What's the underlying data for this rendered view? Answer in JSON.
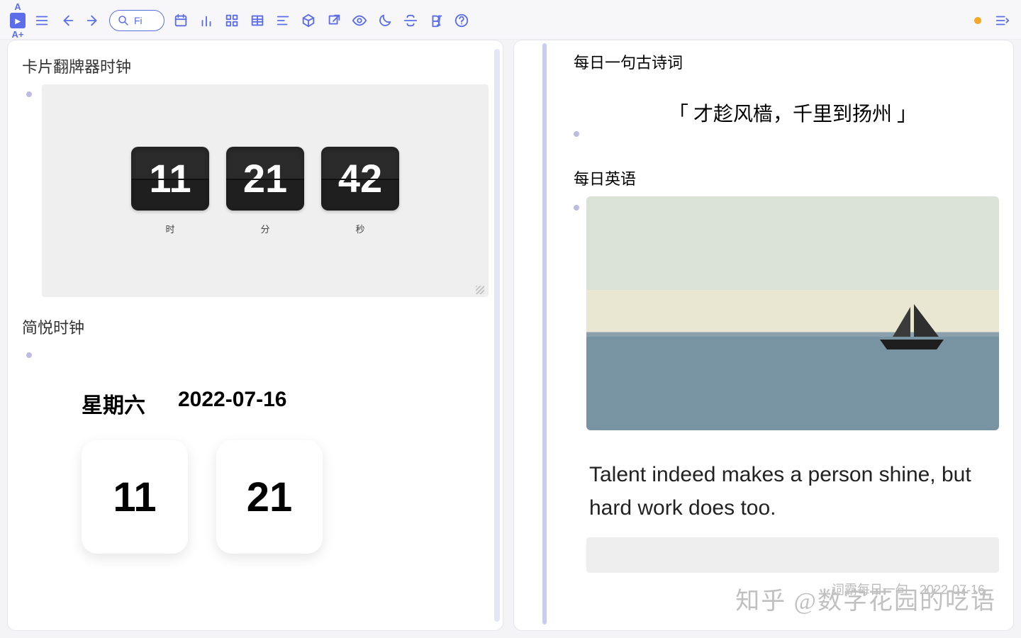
{
  "toolbar": {
    "font_minus": "A",
    "font_plus": "A+",
    "search_value": "Fi"
  },
  "left": {
    "flip_title": "卡片翻牌器时钟",
    "flip_h": "11",
    "flip_m": "21",
    "flip_s": "42",
    "lbl_h": "时",
    "lbl_m": "分",
    "lbl_s": "秒",
    "simple_title": "简悦时钟",
    "weekday": "星期六",
    "date": "2022-07-16",
    "tile_h": "11",
    "tile_m": "21"
  },
  "right": {
    "poem_head": "每日一句古诗词",
    "poem_text": "「 才趁风樯，千里到扬州 」",
    "eng_head": "每日英语",
    "eng_quote": "Talent indeed makes a person shine, but hard work does too.",
    "footer": "词霸每日一句 · 2022-07-16",
    "watermark": "知乎 @数字花园的呓语"
  }
}
